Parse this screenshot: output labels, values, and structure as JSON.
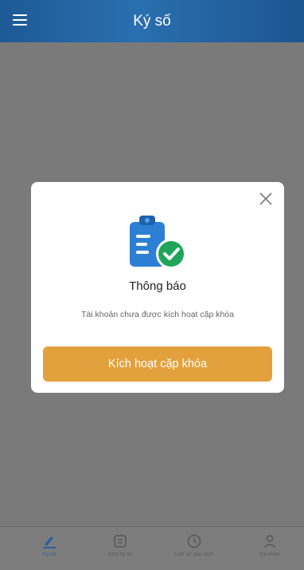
{
  "header": {
    "title": "Ký số",
    "menu_icon": "menu-icon"
  },
  "dialog": {
    "title": "Thông báo",
    "message": "Tài khoản chưa được kích hoạt cặp khóa",
    "button_label": "Kích hoạt cặp khóa",
    "icon": "clipboard-check-icon",
    "close_icon": "close-icon"
  },
  "bottom_nav": {
    "items": [
      {
        "label": "Ký số",
        "icon": "pen-sign-icon",
        "active": true
      },
      {
        "label": "Chờ ký số",
        "icon": "list-icon",
        "active": false
      },
      {
        "label": "Lịch sử giao dịch",
        "icon": "clock-icon",
        "active": false
      },
      {
        "label": "Cá nhân",
        "icon": "person-icon",
        "active": false
      }
    ]
  },
  "colors": {
    "header": "#2a6fb0",
    "accent_button": "#e3a13d",
    "overlay": "#7a7a7a",
    "check_green": "#1fa55a",
    "clipboard_blue": "#2d7fd3"
  }
}
